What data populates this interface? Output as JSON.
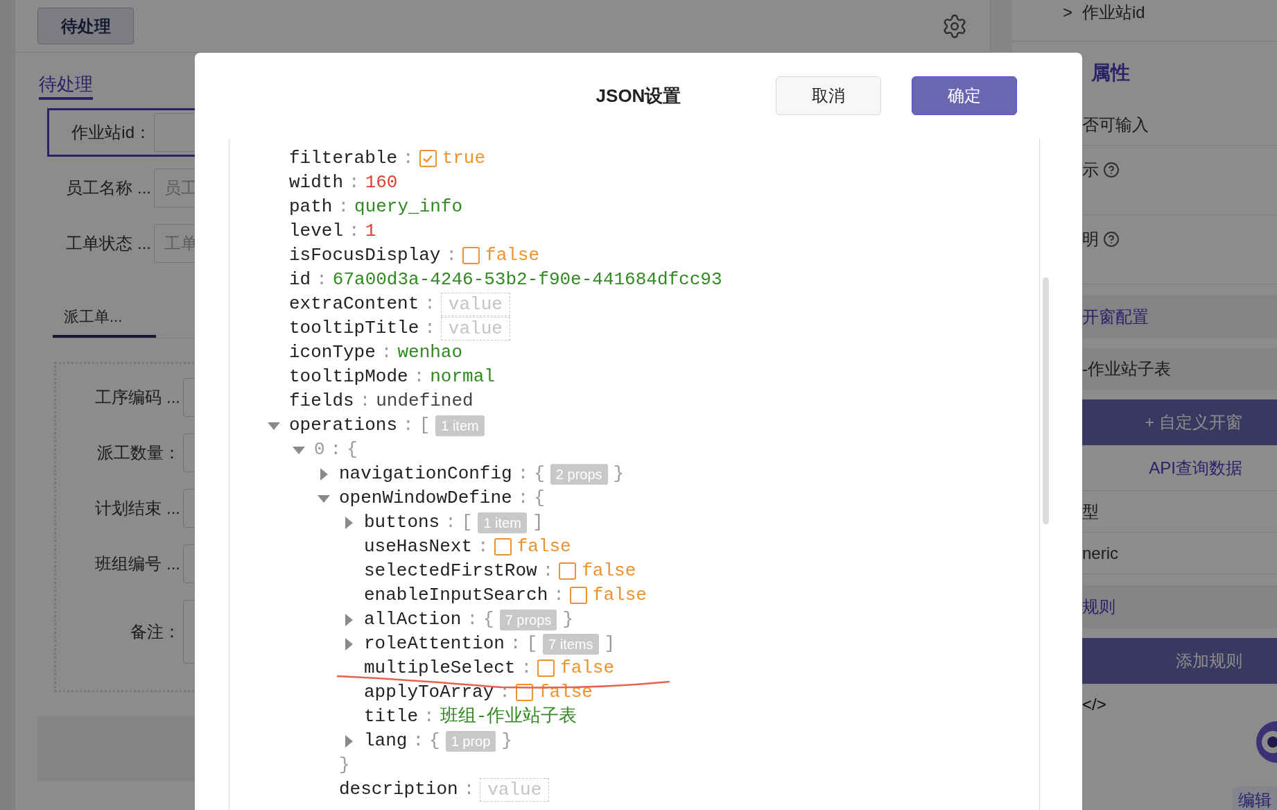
{
  "left": {
    "header_button": "待处理",
    "tab": "待处理",
    "filters": [
      {
        "label": "作业站id：",
        "selected": true
      },
      {
        "label": "员工名称 ...",
        "placeholder": "员工",
        "selected": false
      },
      {
        "label": "工单状态 ...",
        "placeholder": "工单",
        "selected": false
      }
    ],
    "subtab": {
      "label": "派工单...",
      "selected": true
    },
    "form_fields": [
      {
        "label": "工序编码 ...",
        "kind": "input"
      },
      {
        "label": "派工数量：",
        "kind": "input"
      },
      {
        "label": "计划结束 ...",
        "kind": "input"
      },
      {
        "label": "班组编号 ...",
        "kind": "input"
      },
      {
        "label": "备注：",
        "kind": "textarea"
      }
    ]
  },
  "right": {
    "breadcrumb": {
      "arrow": ">",
      "label": "作业站id"
    },
    "section_title": "属性",
    "rows": [
      {
        "kind": "text",
        "text": "否可输入"
      },
      {
        "kind": "help",
        "text": "示"
      },
      {
        "kind": "blank"
      },
      {
        "kind": "help",
        "text": "明"
      },
      {
        "kind": "blank"
      },
      {
        "kind": "section",
        "text": "开窗配置"
      },
      {
        "kind": "value",
        "text": "-作业站子表"
      },
      {
        "kind": "button",
        "text": "+ 自定义开窗"
      },
      {
        "kind": "link",
        "text": "API查询数据"
      },
      {
        "kind": "text",
        "text": "型"
      },
      {
        "kind": "text",
        "text": "neric"
      },
      {
        "kind": "section",
        "text": "规则"
      },
      {
        "kind": "button",
        "text": "添加规则"
      },
      {
        "kind": "code",
        "text": "</>"
      }
    ],
    "edit_button": "编辑"
  },
  "dialog": {
    "title": "JSON设置",
    "separator": ":",
    "buttons": [
      {
        "label": "取消",
        "kind": "default"
      },
      {
        "label": "确定",
        "kind": "primary"
      }
    ],
    "tree": [
      {
        "key": "filterable",
        "kind": "bool",
        "checked": true,
        "value": "true"
      },
      {
        "key": "width",
        "kind": "number",
        "value": "160"
      },
      {
        "key": "path",
        "kind": "string",
        "value": "query_info"
      },
      {
        "key": "level",
        "kind": "number",
        "value": "1"
      },
      {
        "key": "isFocusDisplay",
        "kind": "bool",
        "checked": false,
        "value": "false"
      },
      {
        "key": "id",
        "kind": "string",
        "value": "67a00d3a-4246-53b2-f90e-441684dfcc93"
      },
      {
        "key": "extraContent",
        "kind": "empty",
        "placeholder": "value"
      },
      {
        "key": "tooltipTitle",
        "kind": "empty",
        "placeholder": "value"
      },
      {
        "key": "iconType",
        "kind": "string",
        "value": "wenhao"
      },
      {
        "key": "tooltipMode",
        "kind": "string",
        "value": "normal"
      },
      {
        "key": "fields",
        "kind": "undefined",
        "value": "undefined"
      },
      {
        "key": "operations",
        "kind": "array",
        "expanded": true,
        "open": "[",
        "badge": "1 item",
        "children": [
          {
            "key": "0",
            "kind": "object",
            "expanded": true,
            "open": "{",
            "children": [
              {
                "key": "navigationConfig",
                "kind": "object",
                "expanded": false,
                "open": "{",
                "badge": "2 props",
                "close": "}"
              },
              {
                "key": "openWindowDefine",
                "kind": "object",
                "expanded": true,
                "open": "{",
                "close": "}",
                "children": [
                  {
                    "key": "buttons",
                    "kind": "array",
                    "expanded": false,
                    "open": "[",
                    "badge": "1 item",
                    "close": "]"
                  },
                  {
                    "key": "useHasNext",
                    "kind": "bool",
                    "checked": false,
                    "value": "false"
                  },
                  {
                    "key": "selectedFirstRow",
                    "kind": "bool",
                    "checked": false,
                    "value": "false"
                  },
                  {
                    "key": "enableInputSearch",
                    "kind": "bool",
                    "checked": false,
                    "value": "false"
                  },
                  {
                    "key": "allAction",
                    "kind": "object",
                    "expanded": false,
                    "open": "{",
                    "badge": "7 props",
                    "close": "}"
                  },
                  {
                    "key": "roleAttention",
                    "kind": "array",
                    "expanded": false,
                    "open": "[",
                    "badge": "7 items",
                    "close": "]"
                  },
                  {
                    "key": "multipleSelect",
                    "kind": "bool",
                    "checked": false,
                    "value": "false"
                  },
                  {
                    "key": "applyToArray",
                    "kind": "bool",
                    "checked": false,
                    "value": "false"
                  },
                  {
                    "key": "title",
                    "kind": "string",
                    "value": "班组-作业站子表"
                  },
                  {
                    "key": "lang",
                    "kind": "object",
                    "expanded": false,
                    "open": "{",
                    "badge": "1 prop",
                    "close": "}"
                  }
                ]
              },
              {
                "key": "description",
                "kind": "empty",
                "placeholder": "value"
              }
            ]
          }
        ]
      }
    ]
  }
}
